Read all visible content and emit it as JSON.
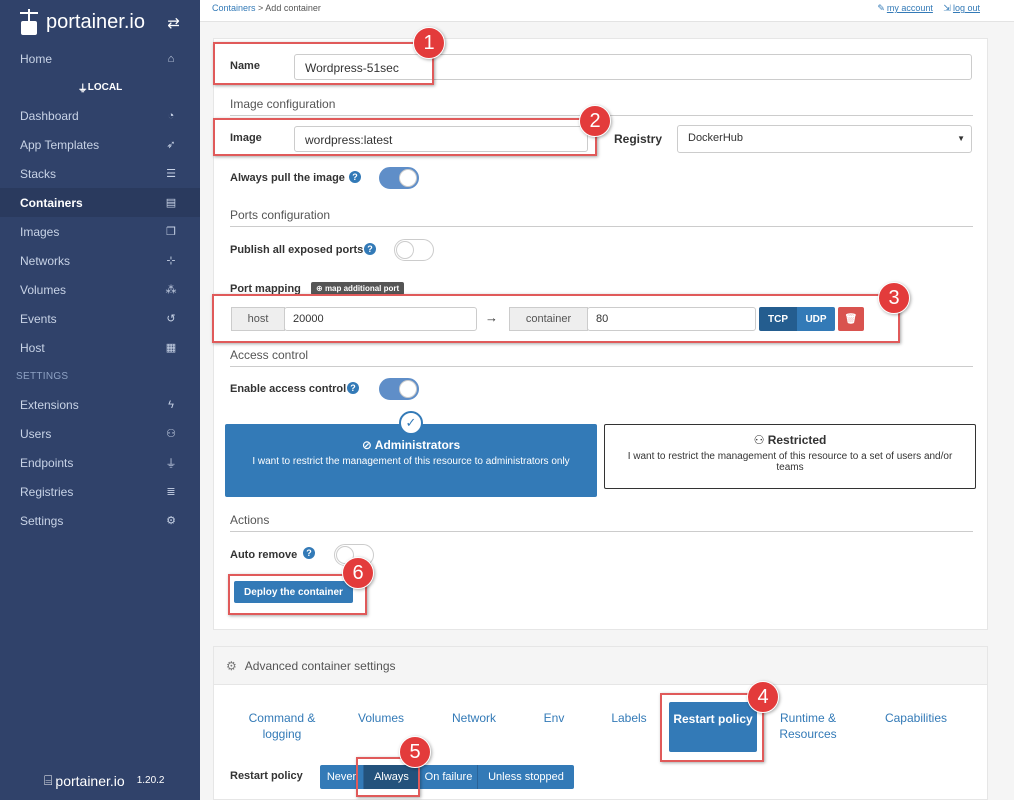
{
  "app": {
    "name": "portainer.io",
    "version": "1.20.2"
  },
  "sidebar": {
    "endpoint": "LOCAL",
    "settings_heading": "SETTINGS",
    "items": [
      {
        "label": "Home",
        "icon": "home-icon",
        "glyph": "⌂"
      },
      {
        "label": "Dashboard",
        "icon": "dashboard-icon",
        "glyph": "◔"
      },
      {
        "label": "App Templates",
        "icon": "rocket-icon",
        "glyph": "➶"
      },
      {
        "label": "Stacks",
        "icon": "list-icon",
        "glyph": "☰"
      },
      {
        "label": "Containers",
        "icon": "server-icon",
        "glyph": "▤",
        "active": true
      },
      {
        "label": "Images",
        "icon": "clone-icon",
        "glyph": "❐"
      },
      {
        "label": "Networks",
        "icon": "sitemap-icon",
        "glyph": "⊹"
      },
      {
        "label": "Volumes",
        "icon": "cubes-icon",
        "glyph": "⁂"
      },
      {
        "label": "Events",
        "icon": "history-icon",
        "glyph": "↺"
      },
      {
        "label": "Host",
        "icon": "grid-icon",
        "glyph": "▦"
      }
    ],
    "settings_items": [
      {
        "label": "Extensions",
        "icon": "bolt-icon",
        "glyph": "ϟ"
      },
      {
        "label": "Users",
        "icon": "users-icon",
        "glyph": "⚇"
      },
      {
        "label": "Endpoints",
        "icon": "plug-icon",
        "glyph": "⏚"
      },
      {
        "label": "Registries",
        "icon": "database-icon",
        "glyph": "≣"
      },
      {
        "label": "Settings",
        "icon": "cogs-icon",
        "glyph": "⚙"
      }
    ]
  },
  "topbar": {
    "breadcrumb_link": "Containers",
    "breadcrumb_current": "> Add container",
    "my_account": "my account",
    "log_out": "log out"
  },
  "form": {
    "name_label": "Name",
    "name_value": "Wordpress-51sec",
    "image_section": "Image configuration",
    "image_label": "Image",
    "image_value": "wordpress:latest",
    "registry_label": "Registry",
    "registry_value": "DockerHub",
    "always_pull_label": "Always pull the image",
    "always_pull": true,
    "ports_section": "Ports configuration",
    "publish_all_label": "Publish all exposed ports",
    "publish_all": false,
    "port_mapping_label": "Port mapping",
    "map_port_button": "map additional port",
    "host_label": "host",
    "host_port": "20000",
    "container_label": "container",
    "container_port": "80",
    "tcp_label": "TCP",
    "udp_label": "UDP",
    "access_section": "Access control",
    "enable_access_label": "Enable access control",
    "enable_access": true,
    "admins_title": "Administrators",
    "admins_desc": "I want to restrict the management of this resource to administrators only",
    "restricted_title": "Restricted",
    "restricted_desc": "I want to restrict the management of this resource to a set of users and/or teams",
    "actions_section": "Actions",
    "auto_remove_label": "Auto remove",
    "auto_remove": false,
    "deploy_button": "Deploy the container"
  },
  "advanced": {
    "title": "Advanced container settings",
    "tabs": [
      {
        "label": "Command & logging"
      },
      {
        "label": "Volumes"
      },
      {
        "label": "Network"
      },
      {
        "label": "Env"
      },
      {
        "label": "Labels"
      },
      {
        "label": "Restart policy",
        "active": true
      },
      {
        "label": "Runtime & Resources"
      },
      {
        "label": "Capabilities"
      }
    ],
    "restart_label": "Restart policy",
    "restart_options": [
      {
        "label": "Never"
      },
      {
        "label": "Always",
        "active": true
      },
      {
        "label": "On failure"
      },
      {
        "label": "Unless stopped"
      }
    ]
  },
  "callouts": [
    "1",
    "2",
    "3",
    "4",
    "5",
    "6"
  ],
  "colors": {
    "sidebar": "#30426a",
    "primary": "#337ab7",
    "danger": "#d9534f",
    "callout": "#e33b3b"
  }
}
